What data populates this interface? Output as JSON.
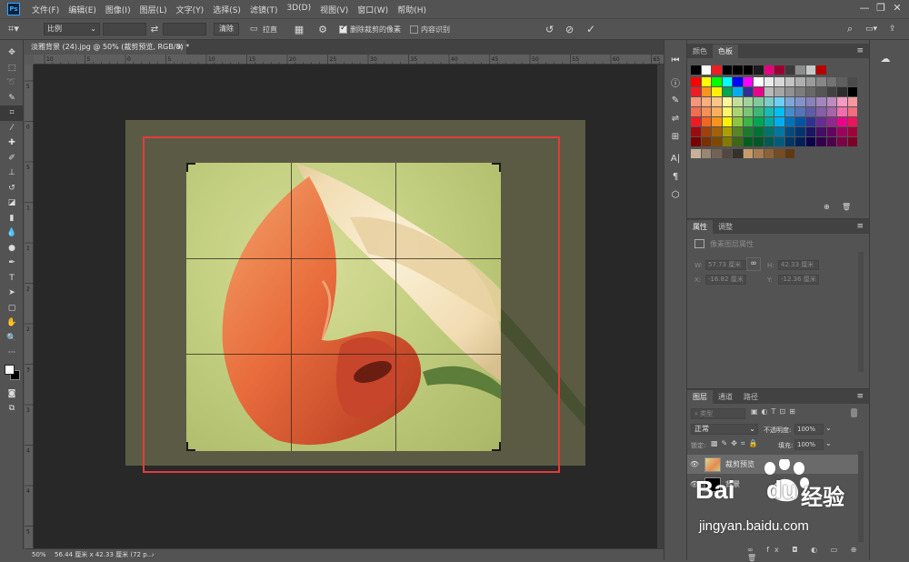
{
  "app": {
    "logo": "Ps"
  },
  "menu": [
    "文件(F)",
    "编辑(E)",
    "图像(I)",
    "图层(L)",
    "文字(Y)",
    "选择(S)",
    "滤镜(T)",
    "3D(D)",
    "视图(V)",
    "窗口(W)",
    "帮助(H)"
  ],
  "window_controls": {
    "minimize": "—",
    "restore": "❐",
    "close": "✕"
  },
  "options": {
    "ratio_label": "比例",
    "clear_label": "清除",
    "straighten_label": "拉直",
    "delete_cropped_label": "删除裁剪的像素",
    "content_aware_label": "内容识别",
    "delete_cropped_checked": true,
    "content_aware_checked": false
  },
  "document": {
    "tab_title": "淡雅背景 (24).jpg @ 50% (裁剪预览, RGB/8) *",
    "tab_close": "×",
    "zoom": "50%",
    "doc_info": "56.44 厘米 x 42.33 厘米 (72 p...",
    "status_arrow": "›"
  },
  "ruler": {
    "h_ticks": [
      "10",
      "5",
      "0",
      "5",
      "10",
      "15",
      "20",
      "25",
      "30",
      "35",
      "40",
      "45",
      "50",
      "55",
      "60",
      "65"
    ],
    "v_ticks": [
      "5",
      "0",
      "5",
      "1",
      "1",
      "2",
      "2",
      "3",
      "3",
      "4",
      "4",
      "5",
      "5"
    ]
  },
  "swatches_panel": {
    "tabs": [
      "颜色",
      "色板"
    ],
    "selected_tab": "色板",
    "rows": [
      [
        "#000000",
        "#ffffff",
        "#ee1d24",
        "#000000",
        "#000000",
        "#000000",
        "#1c1c1c",
        "#e6007e",
        "#9b0032",
        "#3b3b3b",
        "#8d8d8d",
        "#c8c8c8",
        "#b50000"
      ],
      [
        "#fe0000",
        "#ffff00",
        "#00ff00",
        "#00ffff",
        "#0000ff",
        "#ff00ff",
        "#ffffff",
        "#ebebeb",
        "#d7d7d7",
        "#c3c3c3",
        "#afafaf",
        "#9b9b9b",
        "#878787",
        "#737373",
        "#5f5f5f",
        "#4b4b4b"
      ],
      [
        "#ee1c24",
        "#f7941d",
        "#fff200",
        "#00a651",
        "#00aeef",
        "#2e3192",
        "#ec008c",
        "#b9b9b9",
        "#a5a5a5",
        "#919191",
        "#7d7d7d",
        "#696969",
        "#555555",
        "#414141",
        "#2d2d2d",
        "#000000"
      ],
      [
        "#f69679",
        "#f9ad81",
        "#fdc689",
        "#fff799",
        "#c4df9b",
        "#a3d39c",
        "#82ca9c",
        "#7accc8",
        "#6dcff6",
        "#7da7d9",
        "#8393ca",
        "#8781bd",
        "#a186be",
        "#bd8cbf",
        "#f49ac1",
        "#f5989d"
      ],
      [
        "#f26c4f",
        "#f68e56",
        "#fbaf5d",
        "#fff568",
        "#acd372",
        "#7cc576",
        "#3bb878",
        "#1abbb4",
        "#00bff3",
        "#448ccb",
        "#5574b9",
        "#605ca8",
        "#8560a8",
        "#a864a8",
        "#f06eaa",
        "#f26d7d"
      ],
      [
        "#ed1c24",
        "#f26522",
        "#f7941d",
        "#fff200",
        "#8dc63f",
        "#39b54a",
        "#00a651",
        "#00a99d",
        "#00aeef",
        "#0072bc",
        "#0054a6",
        "#2e3192",
        "#662d91",
        "#92278f",
        "#ec008c",
        "#ed145b"
      ],
      [
        "#9e0b0f",
        "#a0410d",
        "#a3620a",
        "#aba000",
        "#598527",
        "#1a7b30",
        "#007236",
        "#00746b",
        "#0076a3",
        "#004b80",
        "#003471",
        "#1b1464",
        "#440e62",
        "#630460",
        "#9e005d",
        "#9e0039"
      ],
      [
        "#790000",
        "#7b2e00",
        "#7d4900",
        "#827b00",
        "#406618",
        "#005e20",
        "#005826",
        "#005952",
        "#005b7f",
        "#003663",
        "#002157",
        "#0d004c",
        "#32004b",
        "#4b0049",
        "#7b0046",
        "#7a0026"
      ],
      [
        "#c7b299",
        "#998675",
        "#736357",
        "#534741",
        "#37302b",
        "#c69c6d",
        "#a67c52",
        "#8c6239",
        "#754c24",
        "#603913"
      ]
    ]
  },
  "properties_panel": {
    "tabs": [
      "属性",
      "调整"
    ],
    "selected_tab": "属性",
    "title": "像素图层属性",
    "w_label": "W:",
    "w_value": "57.73 厘米",
    "h_label": "H:",
    "h_value": "42.33 厘米",
    "x_label": "X:",
    "x_value": "-16.82 厘米",
    "y_label": "Y:",
    "y_value": "-12.36 厘米",
    "link_icon": "∞"
  },
  "layers_panel": {
    "tabs": [
      "图层",
      "通道",
      "路径"
    ],
    "selected_tab": "图层",
    "filter_label": "类型",
    "blend_mode": "正常",
    "opacity_label": "不透明度:",
    "opacity_value": "100%",
    "lock_label": "锁定:",
    "fill_label": "填充:",
    "fill_value": "100%",
    "layers": [
      {
        "name": "裁剪预览",
        "selected": true
      },
      {
        "name": "背景",
        "selected": false
      }
    ]
  },
  "watermark": {
    "brand": "Bai",
    "brand2": "du",
    "cn": "经验",
    "url": "jingyan.baidu.com"
  },
  "colors": {
    "crop_border": "#e33b3b",
    "accent": "#31a8ff"
  }
}
